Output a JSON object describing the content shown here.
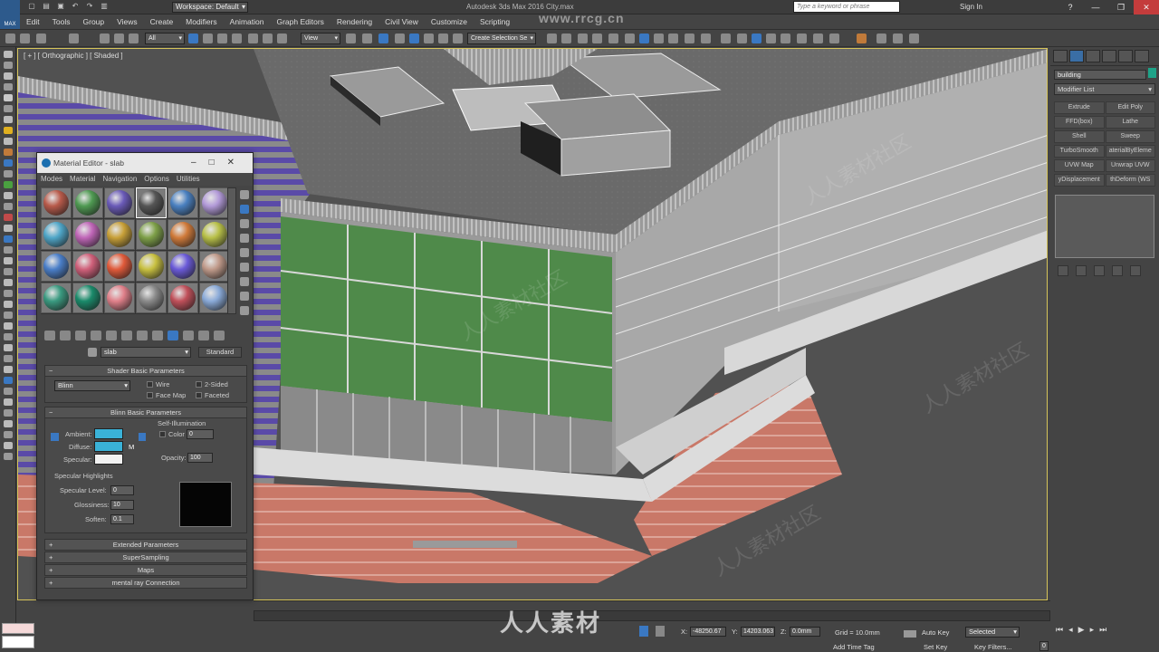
{
  "app": {
    "logo_label": "MAX",
    "workspace": "Workspace: Default",
    "window_title": "Autodesk 3ds Max 2016    City.max",
    "search_placeholder": "Type a keyword or phrase",
    "signin": "Sign In"
  },
  "menu": [
    "Edit",
    "Tools",
    "Group",
    "Views",
    "Create",
    "Modifiers",
    "Animation",
    "Graph Editors",
    "Rendering",
    "Civil View",
    "Customize",
    "Scripting"
  ],
  "toolbar": {
    "filter_select": "All",
    "ref_coord_select": "View",
    "named_selection": "Create Selection Se"
  },
  "viewport": {
    "label": "[ + ] [ Orthographic ] [ Shaded ]"
  },
  "command_panel": {
    "object_name": "building",
    "object_color": "#1ea388",
    "modifier_list": "Modifier List",
    "modifier_buttons": [
      "Extrude",
      "Edit Poly",
      "FFD(box)",
      "Lathe",
      "Shell",
      "Sweep",
      "TurboSmooth",
      "aterialByEleme",
      "UVW Map",
      "Unwrap UVW",
      "yDisplacement",
      "thDeform (WS"
    ]
  },
  "material_editor": {
    "title": "Material Editor - slab",
    "menu": [
      "Modes",
      "Material",
      "Navigation",
      "Options",
      "Utilities"
    ],
    "slot_colors": [
      "#b85a4a",
      "#4f9a52",
      "#6a5ab8",
      "#555555",
      "#4a80c0",
      "#b29ad8",
      "#4fa6c8",
      "#c066b8",
      "#c8a038",
      "#7ea048",
      "#d07a3a",
      "#b8c048",
      "#4a7ec8",
      "#d0607a",
      "#e05a3a",
      "#c8c040",
      "#6a5ad8",
      "#c09a8a",
      "#3a9a80",
      "#1a8a6a",
      "#e0808a",
      "#8a8a8a",
      "#c0505a",
      "#8aaad8"
    ],
    "selected_slot": 3,
    "material_name": "slab",
    "material_type": "Standard",
    "shader_rollout": "Shader Basic Parameters",
    "shader": "Blinn",
    "wire": "Wire",
    "two_sided": "2-Sided",
    "face_map": "Face Map",
    "faceted": "Faceted",
    "blinn_rollout": "Blinn Basic Parameters",
    "self_illum": "Self-Illumination",
    "color_label": "Color",
    "color_value": "0",
    "ambient": "Ambient:",
    "diffuse": "Diffuse:",
    "specular": "Specular:",
    "ambient_color": "#3ab2d8",
    "diffuse_color": "#3ab2d8",
    "specular_color": "#f2f2f2",
    "m_label": "M",
    "opacity_label": "Opacity:",
    "opacity_value": "100",
    "spec_highlights": "Specular Highlights",
    "spec_level_label": "Specular Level:",
    "spec_level": "0",
    "glossiness_label": "Glossiness:",
    "glossiness": "10",
    "soften_label": "Soften:",
    "soften": "0.1",
    "collapsed_rollouts": [
      "Extended Parameters",
      "SuperSampling",
      "Maps",
      "mental ray Connection"
    ]
  },
  "status": {
    "x": "-48250.67",
    "y": "14203.063",
    "z": "0.0mm",
    "grid": "Grid = 10.0mm",
    "auto_key": "Auto Key",
    "selected": "Selected",
    "set_key": "Set Key",
    "key_filters": "Key Filters...",
    "add_time_tag": "Add Time Tag",
    "frame": "0"
  },
  "watermarks": {
    "site": "www.rrcg.cn",
    "logo": "人人素材",
    "tile": "人人素材社区"
  }
}
